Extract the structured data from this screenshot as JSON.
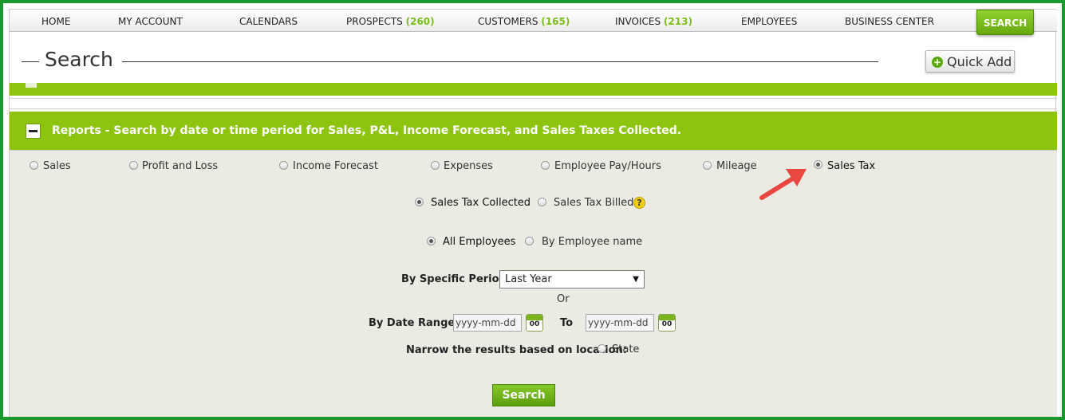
{
  "nav": {
    "items": [
      {
        "label": "HOME",
        "count": ""
      },
      {
        "label": "MY ACCOUNT",
        "count": ""
      },
      {
        "label": "CALENDARS",
        "count": ""
      },
      {
        "label": "PROSPECTS",
        "count": "(260)"
      },
      {
        "label": "CUSTOMERS",
        "count": "(165)"
      },
      {
        "label": "INVOICES",
        "count": "(213)"
      },
      {
        "label": "EMPLOYEES",
        "count": ""
      },
      {
        "label": "BUSINESS CENTER",
        "count": ""
      }
    ],
    "search_label": "SEARCH"
  },
  "header": {
    "title": "Search",
    "quick_add_label": "Quick Add"
  },
  "reports": {
    "title": "Reports - Search by date or time period for Sales, P&L, Income Forecast, and Sales Taxes Collected.",
    "report_types": [
      {
        "label": "Sales",
        "checked": false
      },
      {
        "label": "Profit and Loss",
        "checked": false
      },
      {
        "label": "Income Forecast",
        "checked": false
      },
      {
        "label": "Expenses",
        "checked": false
      },
      {
        "label": "Employee Pay/Hours",
        "checked": false
      },
      {
        "label": "Mileage",
        "checked": false
      },
      {
        "label": "Sales Tax",
        "checked": true
      }
    ],
    "tax_options": [
      {
        "label": "Sales Tax Collected",
        "checked": true
      },
      {
        "label": "Sales Tax Billed",
        "checked": false
      }
    ],
    "employee_options": [
      {
        "label": "All Employees",
        "checked": true
      },
      {
        "label": "By Employee name",
        "checked": false
      }
    ],
    "period_label": "By Specific Period:",
    "period_value": "Last Year",
    "or_label": "Or",
    "date_range_label": "By Date Range:",
    "from_placeholder": "yyyy-mm-dd",
    "to_label": "To",
    "to_placeholder": "yyyy-mm-dd",
    "calendar_day": "00",
    "location_label": "Narrow the results based on location:",
    "location_option": "State",
    "search_button": "Search",
    "help_glyph": "?"
  },
  "colors": {
    "brand_green": "#8cc410",
    "frame_green": "#1a9a2e",
    "count_green": "#7cbd1e",
    "annotation_arrow": "#e8483f"
  },
  "icons": [
    "plus-circle-icon",
    "collapse-minus-icon",
    "help-icon",
    "calendar-icon",
    "dropdown-caret-icon",
    "annotation-arrow-icon"
  ]
}
